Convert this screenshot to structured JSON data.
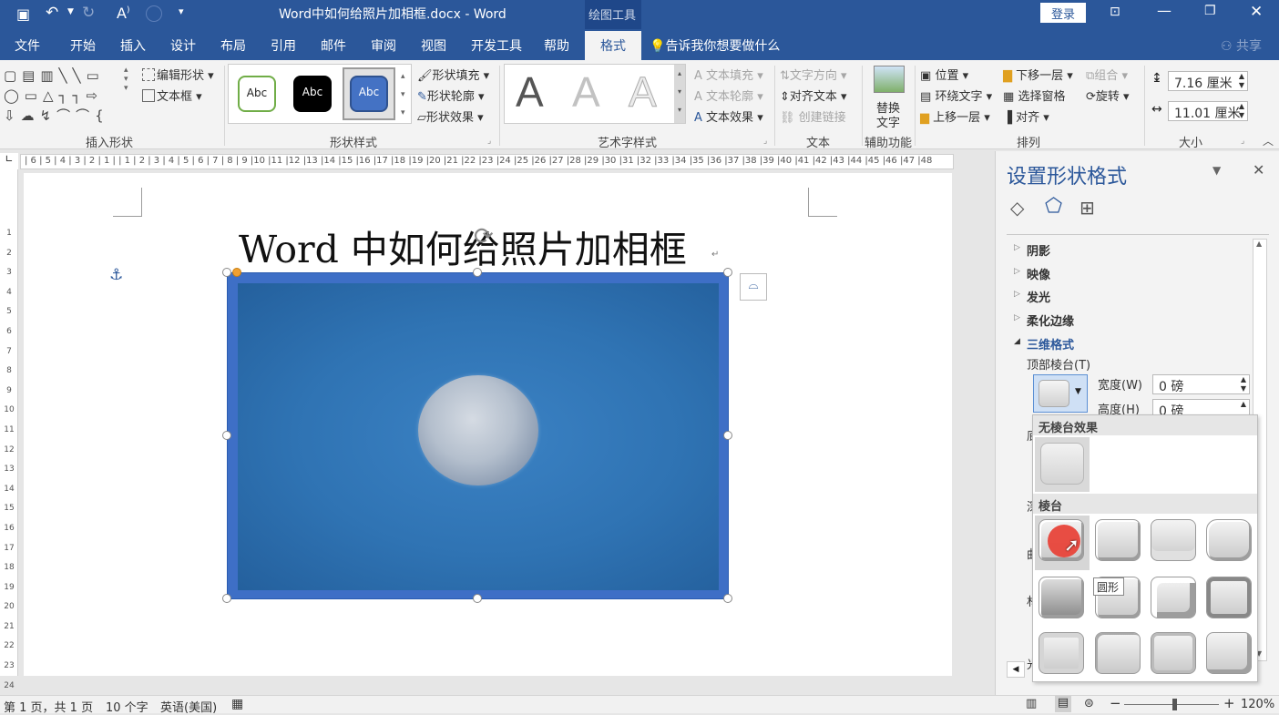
{
  "titlebar": {
    "doc_title": "Word中如何给照片加相框.docx  -  Word",
    "context_tab": "绘图工具",
    "login": "登录",
    "font_glyph": "A"
  },
  "tabs": [
    {
      "label": "文件"
    },
    {
      "label": "开始"
    },
    {
      "label": "插入"
    },
    {
      "label": "设计"
    },
    {
      "label": "布局"
    },
    {
      "label": "引用"
    },
    {
      "label": "邮件"
    },
    {
      "label": "审阅"
    },
    {
      "label": "视图"
    },
    {
      "label": "开发工具"
    },
    {
      "label": "帮助"
    },
    {
      "label": "格式"
    }
  ],
  "tell_me": "告诉我你想要做什么",
  "share": "共享",
  "ribbon": {
    "insert_shapes": {
      "label": "插入形状",
      "edit_shape": "编辑形状",
      "text_box": "文本框"
    },
    "shape_styles": {
      "label": "形状样式",
      "style1": "Abc",
      "style2": "Abc",
      "style3": "Abc",
      "fill": "形状填充",
      "outline": "形状轮廓",
      "effects": "形状效果"
    },
    "wordart": {
      "label": "艺术字样式",
      "glyph": "A",
      "text_fill": "文本填充",
      "text_outline": "文本轮廓",
      "text_effects": "文本效果"
    },
    "text": {
      "label": "文本",
      "direction": "文字方向",
      "align": "对齐文本",
      "link": "创建链接"
    },
    "accessibility": {
      "label": "辅助功能",
      "alt_text_1": "替换",
      "alt_text_2": "文字"
    },
    "arrange": {
      "label": "排列",
      "position": "位置",
      "wrap": "环绕文字",
      "bring_forward": "上移一层",
      "send_backward": "下移一层",
      "selection_pane": "选择窗格",
      "align": "对齐",
      "group": "组合",
      "rotate": "旋转"
    },
    "size": {
      "label": "大小",
      "height": "7.16 厘米",
      "width": "11.01 厘米"
    }
  },
  "ruler": "| 6 | 5 | 4 | 3 | 2 | 1 |  | 1 | 2 | 3 | 4 | 5 | 6 | 7 | 8 | 9 |10 |11 |12 |13 |14 |15 |16 |17 |18 |19 |20 |21 |22 |23 |24 |25 |26 |27 |28 |29 |30 |31 |32 |33 |34 |35 |36 |37 |38 |39 |40 |41 |42 |43 |44 |45 |46 |47 |48",
  "vruler_numbers": [
    "1",
    "2",
    "3",
    "4",
    "5",
    "6",
    "7",
    "8",
    "9",
    "10",
    "11",
    "12",
    "13",
    "14",
    "15",
    "16",
    "17",
    "18",
    "19",
    "20",
    "21",
    "22",
    "23",
    "24"
  ],
  "document": {
    "heading": "Word 中如何给照片加相框",
    "anchor": "⚓"
  },
  "pane": {
    "title": "设置形状格式",
    "sections": [
      {
        "label": "阴影"
      },
      {
        "label": "映像"
      },
      {
        "label": "发光"
      },
      {
        "label": "柔化边缘"
      },
      {
        "label": "三维格式"
      }
    ],
    "top_bevel": "顶部棱台(T)",
    "width_label": "宽度(W)",
    "width_value": "0 磅",
    "height_label": "高度(H)",
    "height_value": "0 磅",
    "hidden_labels": [
      "底",
      "深",
      "曲",
      "材",
      "光"
    ]
  },
  "bevel_popup": {
    "no_bevel": "无棱台效果",
    "bevel": "棱台",
    "tooltip": "圆形"
  },
  "status": {
    "page": "第 1 页，共 1 页",
    "words": "10 个字",
    "lang": "英语(美国)",
    "zoom": "120%"
  },
  "colors": {
    "accent": "#2b579a",
    "photo": "#2f73b3",
    "frame": "#3e6fc6",
    "cursor_dot": "#e8443a"
  }
}
